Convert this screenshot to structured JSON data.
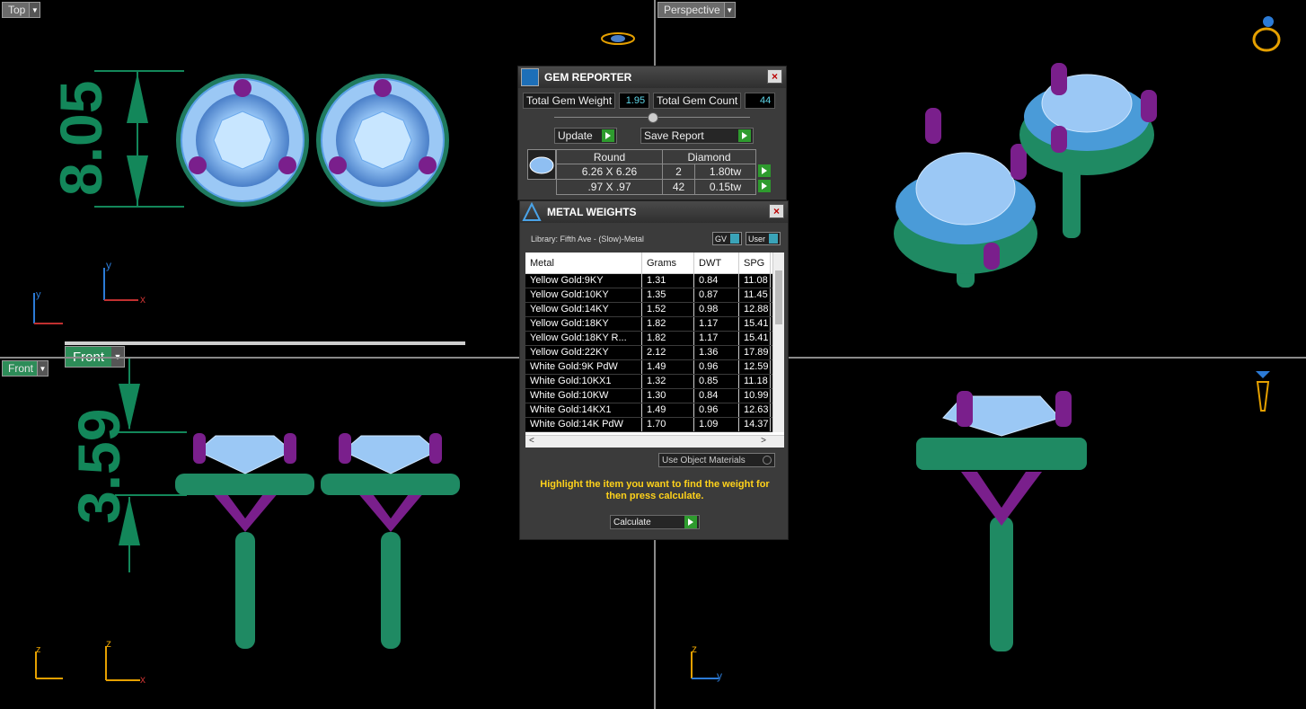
{
  "viewports": {
    "top": {
      "label": "Top",
      "dim_value": "8.05"
    },
    "perspective": {
      "label": "Perspective"
    },
    "front": {
      "label": "Front",
      "label2": "Front",
      "dim_value": "3.59"
    },
    "right": {
      "label": ""
    }
  },
  "axes": {
    "x": "x",
    "y": "y",
    "z": "z"
  },
  "gem_reporter": {
    "title": "GEM REPORTER",
    "total_weight_label": "Total Gem Weight",
    "total_weight_value": "1.95",
    "total_count_label": "Total Gem Count",
    "total_count_value": "44",
    "update_label": "Update",
    "save_label": "Save Report",
    "table": {
      "headers": [
        "Round",
        "Diamond"
      ],
      "rows": [
        {
          "size": "6.26 X 6.26",
          "count": "2",
          "tw": "1.80tw"
        },
        {
          "size": ".97 X .97",
          "count": "42",
          "tw": "0.15tw"
        }
      ]
    }
  },
  "metal_weights": {
    "title": "METAL WEIGHTS",
    "library": "Library: Fifth Ave - (Slow)-Metal",
    "gv_label": "GV",
    "user_label": "User",
    "columns": [
      "Metal",
      "Grams",
      "DWT",
      "SPG"
    ],
    "rows": [
      [
        "Yellow Gold:9KY",
        "1.31",
        "0.84",
        "11.08"
      ],
      [
        "Yellow Gold:10KY",
        "1.35",
        "0.87",
        "11.45"
      ],
      [
        "Yellow Gold:14KY",
        "1.52",
        "0.98",
        "12.88"
      ],
      [
        "Yellow Gold:18KY",
        "1.82",
        "1.17",
        "15.41"
      ],
      [
        "Yellow Gold:18KY R...",
        "1.82",
        "1.17",
        "15.41"
      ],
      [
        "Yellow Gold:22KY",
        "2.12",
        "1.36",
        "17.89"
      ],
      [
        "White Gold:9K PdW",
        "1.49",
        "0.96",
        "12.59"
      ],
      [
        "White Gold:10KX1",
        "1.32",
        "0.85",
        "11.18"
      ],
      [
        "White Gold:10KW",
        "1.30",
        "0.84",
        "10.99"
      ],
      [
        "White Gold:14KX1",
        "1.49",
        "0.96",
        "12.63"
      ],
      [
        "White Gold:14K PdW",
        "1.70",
        "1.09",
        "14.37"
      ]
    ],
    "use_object_materials": "Use Object Materials",
    "instruction": "Highlight the item you want to find the weight for then press calculate.",
    "calculate_label": "Calculate"
  },
  "colors": {
    "metal_green": "#1f8a63",
    "stone_blue": "#8fbff2",
    "prong_purple": "#7a1f8c",
    "dimension_green": "#13875a",
    "highlight_yellow": "#ffd21a"
  }
}
